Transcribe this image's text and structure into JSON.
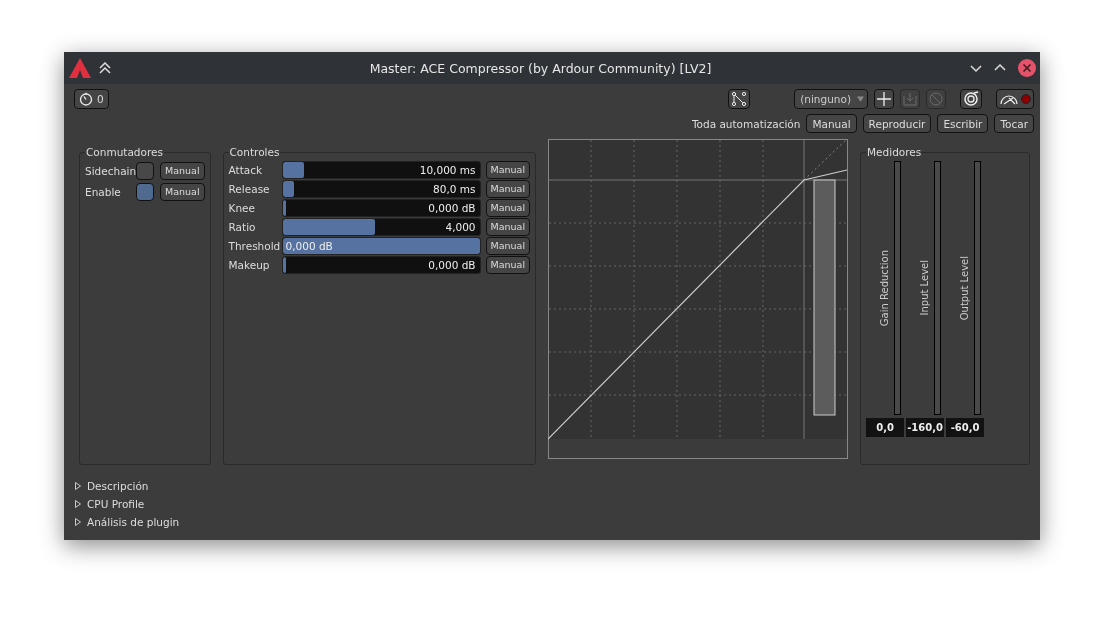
{
  "window": {
    "title": "Master: ACE Compressor (by Ardour Community) [LV2]"
  },
  "toolbar": {
    "latency_button": "0",
    "preset": "(ninguno)",
    "icon_buttons": [
      {
        "kind": "routing",
        "disabled": false
      },
      {
        "kind": "add",
        "disabled": false
      },
      {
        "kind": "save",
        "disabled": true
      },
      {
        "kind": "delete",
        "disabled": true
      },
      {
        "kind": "bypass",
        "disabled": false
      },
      {
        "kind": "meter",
        "disabled": false
      }
    ]
  },
  "automation": {
    "label": "Toda automatización",
    "buttons": [
      "Manual",
      "Reproducir",
      "Escribir",
      "Tocar"
    ]
  },
  "switches": {
    "title": "Conmutadores",
    "items": [
      {
        "label": "Sidechain",
        "on": false,
        "button": "Manual"
      },
      {
        "label": "Enable",
        "on": true,
        "button": "Manual"
      }
    ]
  },
  "controls": {
    "title": "Controles",
    "items": [
      {
        "label": "Attack",
        "level": 0.11,
        "value": "10,000 ms",
        "button": "Manual"
      },
      {
        "label": "Release",
        "level": 0.06,
        "value": "80,0 ms",
        "button": "Manual"
      },
      {
        "label": "Knee",
        "level": 0.01,
        "value": "0,000 dB",
        "button": "Manual"
      },
      {
        "label": "Ratio",
        "level": 0.47,
        "value": "4,000",
        "button": "Manual"
      },
      {
        "label": "Threshold",
        "level": 1,
        "value": "0,000 dB",
        "button": "Manual"
      },
      {
        "label": "Makeup",
        "level": 0.01,
        "value": "0,000 dB",
        "button": "Manual"
      }
    ]
  },
  "meters": {
    "title": "Medidores",
    "items": [
      {
        "label": "Gain Reduction",
        "reading": "0,0"
      },
      {
        "label": "Input Level",
        "reading": "-160,0"
      },
      {
        "label": "Output Level",
        "reading": "-60,0"
      }
    ]
  },
  "expanders": [
    {
      "label": "Descripción",
      "expanded": false
    },
    {
      "label": "CPU Profile",
      "expanded": false
    },
    {
      "label": "Análisis de plugin",
      "expanded": false
    }
  ]
}
